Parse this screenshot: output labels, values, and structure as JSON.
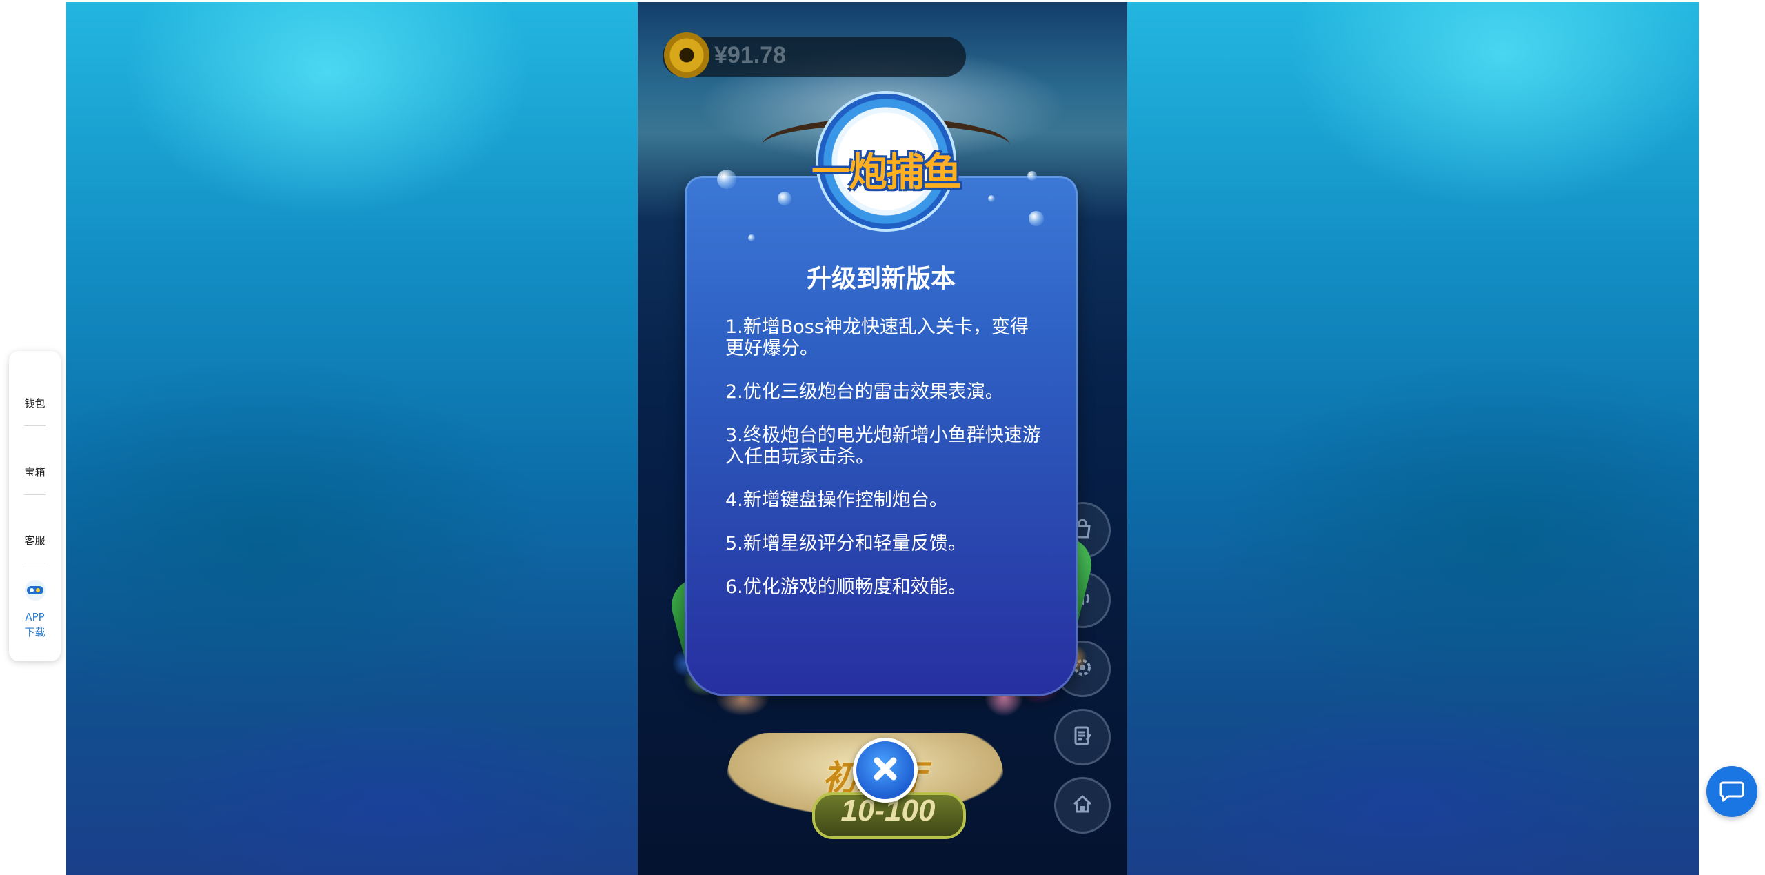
{
  "side_menu": {
    "items": [
      {
        "label": "钱包",
        "icon": "wallet-icon"
      },
      {
        "label": "宝箱",
        "icon": "treasure-chest-icon"
      },
      {
        "label": "客服",
        "icon": "customer-service-icon"
      }
    ],
    "app_download": {
      "icon": "app-logo-icon",
      "label": "APP\n下载"
    }
  },
  "game": {
    "wallet": {
      "amount": "¥91.78",
      "icon": "coin-icon"
    },
    "right_buttons": [
      {
        "icon": "shop-icon"
      },
      {
        "icon": "sound-icon"
      },
      {
        "icon": "settings-icon"
      },
      {
        "icon": "notes-icon"
      },
      {
        "icon": "home-icon"
      }
    ],
    "hall": {
      "title": "初级厅",
      "range": "10-100"
    }
  },
  "update_modal": {
    "logo_text": "一炮捕鱼",
    "title": "升级到新版本",
    "items": [
      "1.新增Boss神龙快速乱入关卡，变得更好爆分。",
      "2.优化三级炮台的雷击效果表演。",
      "3.终极炮台的电光炮新增小鱼群快速游入任由玩家击杀。",
      "4.新增键盘操作控制炮台。",
      "5.新增星级评分和轻量反馈。",
      "6.优化游戏的顺畅度和效能。"
    ],
    "close_icon": "close-icon"
  },
  "chat": {
    "icon": "chat-icon",
    "color": "#1a76e3"
  }
}
